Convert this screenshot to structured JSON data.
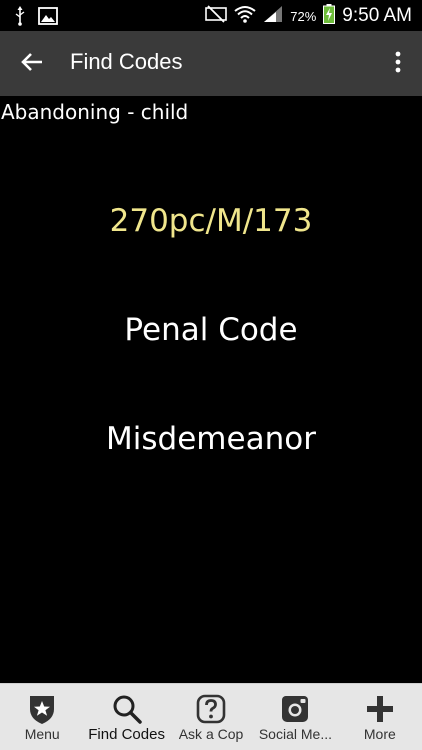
{
  "status_bar": {
    "battery_percent": "72%",
    "time": "9:50 AM"
  },
  "app_bar": {
    "title": "Find Codes"
  },
  "content": {
    "topic": "Abandoning - child",
    "code_number": "270pc/M/173",
    "code_type": "Penal Code",
    "code_class": "Misdemeanor"
  },
  "colors": {
    "app_bar_bg": "#3a3a3a",
    "code_number": "#f0e68c",
    "bottom_nav_bg": "#e6e6e6"
  },
  "bottom_nav": {
    "items": [
      {
        "label": "Menu",
        "icon": "badge-star-icon"
      },
      {
        "label": "Find Codes",
        "icon": "search-icon"
      },
      {
        "label": "Ask a Cop",
        "icon": "question-icon"
      },
      {
        "label": "Social Me...",
        "icon": "instagram-icon"
      },
      {
        "label": "More",
        "icon": "plus-icon"
      }
    ]
  }
}
